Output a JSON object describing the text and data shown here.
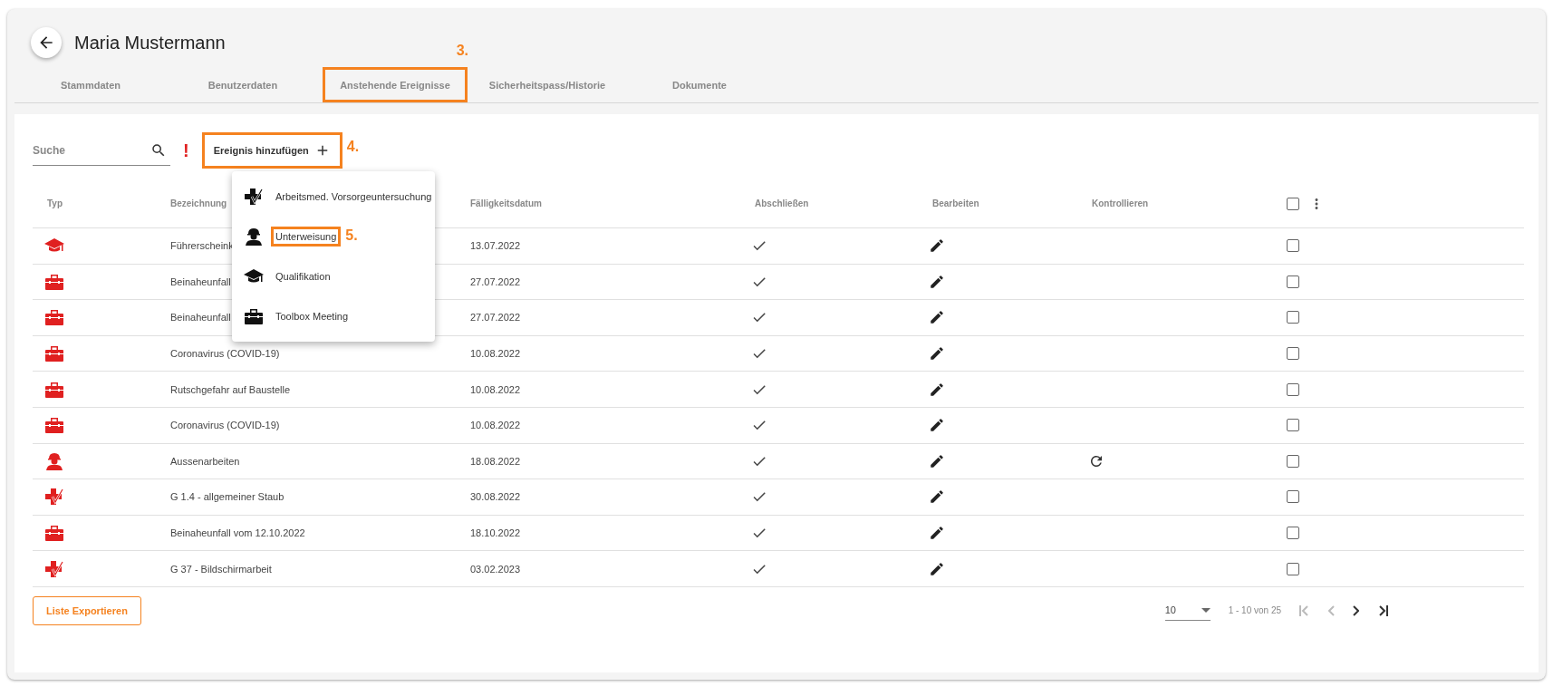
{
  "header": {
    "title": "Maria Mustermann"
  },
  "tabs": [
    {
      "label": "Stammdaten"
    },
    {
      "label": "Benutzerdaten"
    },
    {
      "label": "Anstehende Ereignisse",
      "callout": "3."
    },
    {
      "label": "Sicherheitspass/Historie"
    },
    {
      "label": "Dokumente"
    }
  ],
  "search": {
    "placeholder": "Suche"
  },
  "alert": "!",
  "add_button": {
    "label": "Ereignis hinzufügen",
    "callout": "4."
  },
  "add_menu": [
    {
      "kind": "medical",
      "label": "Arbeitsmed. Vorsorgeuntersuchung"
    },
    {
      "kind": "worker",
      "label": "Unterweisung",
      "callout": "5."
    },
    {
      "kind": "qualification",
      "label": "Qualifikation"
    },
    {
      "kind": "toolbox",
      "label": "Toolbox Meeting"
    }
  ],
  "table": {
    "columns": [
      "Typ",
      "Bezeichnung",
      "Fälligkeitsdatum",
      "Abschließen",
      "Bearbeiten",
      "Kontrollieren"
    ],
    "select_all": {
      "checked": false
    },
    "rows": [
      {
        "kind": "qualification",
        "name": "Führerscheink",
        "date": "13.07.2022",
        "resettable": false,
        "checked": false
      },
      {
        "kind": "toolbox",
        "name": "Beinaheunfall",
        "date": "27.07.2022",
        "resettable": false,
        "checked": false
      },
      {
        "kind": "toolbox",
        "name": "Beinaheunfall",
        "date": "27.07.2022",
        "resettable": false,
        "checked": false
      },
      {
        "kind": "toolbox",
        "name": "Coronavirus (COVID-19)",
        "date": "10.08.2022",
        "resettable": false,
        "checked": false
      },
      {
        "kind": "toolbox",
        "name": "Rutschgefahr auf Baustelle",
        "date": "10.08.2022",
        "resettable": false,
        "checked": false
      },
      {
        "kind": "toolbox",
        "name": "Coronavirus (COVID-19)",
        "date": "10.08.2022",
        "resettable": false,
        "checked": false
      },
      {
        "kind": "worker",
        "name": "Aussenarbeiten",
        "date": "18.08.2022",
        "resettable": true,
        "checked": false
      },
      {
        "kind": "medical",
        "name": "G 1.4 - allgemeiner Staub",
        "date": "30.08.2022",
        "resettable": false,
        "checked": false
      },
      {
        "kind": "toolbox",
        "name": "Beinaheunfall vom 12.10.2022",
        "date": "18.10.2022",
        "resettable": false,
        "checked": false
      },
      {
        "kind": "medical",
        "name": "G 37 - Bildschirmarbeit",
        "date": "03.02.2023",
        "resettable": false,
        "checked": false
      }
    ]
  },
  "export_button": "Liste Exportieren",
  "pagination": {
    "page_size": "10",
    "range": "1 - 10 von 25",
    "buttons": [
      {
        "kind": "first",
        "disabled": true
      },
      {
        "kind": "prev",
        "disabled": true
      },
      {
        "kind": "next",
        "disabled": false
      },
      {
        "kind": "last",
        "disabled": false
      }
    ]
  }
}
